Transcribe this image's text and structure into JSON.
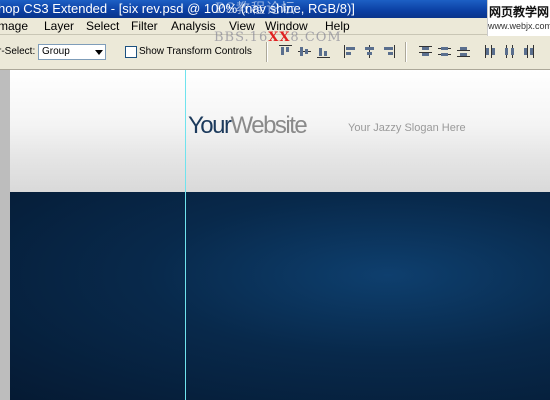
{
  "window": {
    "title": "hop CS3 Extended - [six rev.psd @ 100% (nav shine, RGB/8)]",
    "watermark_mid": "PS教程论坛",
    "watermark_badge_top": "网页教学网",
    "watermark_badge_bottom": "www.webjx.com"
  },
  "menubar": {
    "items": [
      "mage",
      "Layer",
      "Select",
      "Filter",
      "Analysis",
      "View",
      "Window",
      "Help"
    ]
  },
  "watermark_overlay": {
    "prefix": "BBS.16",
    "red": "XX",
    "suffix": "8.COM"
  },
  "options": {
    "autoselect_label": "r-Select:",
    "autoselect_value": "Group",
    "show_transform_label": "Show Transform Controls",
    "show_transform_checked": false
  },
  "canvas": {
    "logo_part1": "Your",
    "logo_part2": "Website",
    "slogan": "Your Jazzy Slogan Here"
  },
  "colors": {
    "title_bar": "#0b3fa3",
    "menu_bg": "#ece9d8",
    "logo_dark": "#1c3a5c",
    "logo_light": "#8a8a8a",
    "nav_band": "#08294b",
    "guide": "#6fe3ee"
  }
}
